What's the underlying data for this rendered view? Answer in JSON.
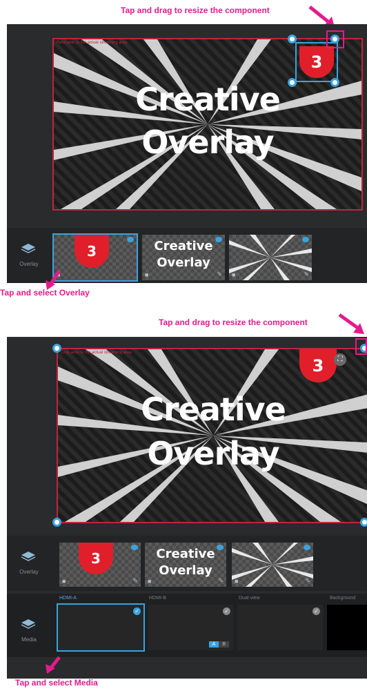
{
  "annotations": {
    "top_resize": "Tap and drag to resize the component",
    "select_overlay": "Tap and select Overlay",
    "bottom_resize": "Tap and drag to resize the component",
    "select_media": "Tap and select Media"
  },
  "stage": {
    "overlay_text_line1": "Creative",
    "overlay_text_line2": "Overlay",
    "badge_number": "3",
    "hint_top": "Resizable to the actual streaming area",
    "hint_bottom": "Crop area to the actual streaming area"
  },
  "overlay_tray": {
    "label": "Overlay",
    "items": [
      {
        "kind": "badge",
        "text": "3"
      },
      {
        "kind": "text",
        "line1": "Creative",
        "line2": "Overlay"
      },
      {
        "kind": "rays",
        "text": ""
      }
    ]
  },
  "media_tray": {
    "label": "Media",
    "sources": [
      "HDMI-A",
      "HDMI-B",
      "Dual-view",
      "Background"
    ],
    "ab": {
      "a": "A",
      "b": "B"
    }
  },
  "colors": {
    "accent": "#3aa3df",
    "annotation": "#e21b8c",
    "badge": "#e01f2a",
    "stage_border": "#c4243a"
  },
  "icons": [
    "layers-icon",
    "eye-icon",
    "trash-icon",
    "pencil-icon",
    "check-icon",
    "crop-icon",
    "arrow-icon"
  ]
}
